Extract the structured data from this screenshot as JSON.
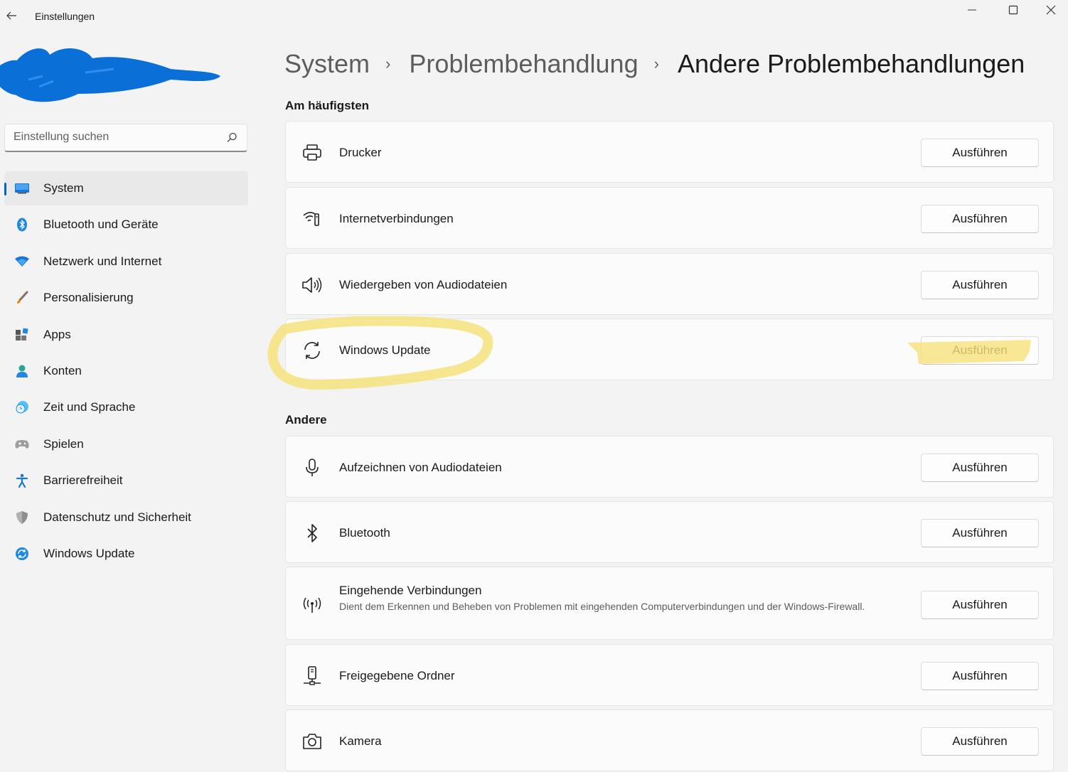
{
  "window": {
    "title": "Einstellungen",
    "controls": [
      "minimize-icon",
      "maximize-icon",
      "close-icon"
    ]
  },
  "search": {
    "placeholder": "Einstellung suchen"
  },
  "sidebar": {
    "items": [
      {
        "label": "System",
        "icon": "system-icon",
        "active": true
      },
      {
        "label": "Bluetooth und Geräte",
        "icon": "bluetooth-icon"
      },
      {
        "label": "Netzwerk und Internet",
        "icon": "wifi-icon"
      },
      {
        "label": "Personalisierung",
        "icon": "brush-icon"
      },
      {
        "label": "Apps",
        "icon": "apps-icon"
      },
      {
        "label": "Konten",
        "icon": "account-icon"
      },
      {
        "label": "Zeit und Sprache",
        "icon": "clock-globe-icon"
      },
      {
        "label": "Spielen",
        "icon": "gamepad-icon"
      },
      {
        "label": "Barrierefreiheit",
        "icon": "accessibility-icon"
      },
      {
        "label": "Datenschutz und Sicherheit",
        "icon": "shield-icon"
      },
      {
        "label": "Windows Update",
        "icon": "windows-update-icon"
      }
    ]
  },
  "header": {
    "breadcrumb": [
      "System",
      "Problembehandlung",
      "Andere Problembehandlungen"
    ],
    "separator": "›"
  },
  "sections": [
    {
      "title": "Am häufigsten",
      "items": [
        {
          "title": "Drucker",
          "icon": "printer-icon",
          "button": "Ausführen"
        },
        {
          "title": "Internetverbindungen",
          "icon": "wifi-signal-icon",
          "button": "Ausführen"
        },
        {
          "title": "Wiedergeben von Audiodateien",
          "icon": "speaker-icon",
          "button": "Ausführen"
        },
        {
          "title": "Windows Update",
          "icon": "refresh-icon",
          "button": "Ausführen"
        }
      ]
    },
    {
      "title": "Andere",
      "items": [
        {
          "title": "Aufzeichnen von Audiodateien",
          "icon": "microphone-icon",
          "button": "Ausführen"
        },
        {
          "title": "Bluetooth",
          "icon": "bluetooth-icon",
          "button": "Ausführen"
        },
        {
          "title": "Eingehende Verbindungen",
          "description": "Dient dem Erkennen und Beheben von Problemen mit eingehenden Computerverbindungen und der Windows-Firewall.",
          "icon": "broadcast-icon",
          "button": "Ausführen"
        },
        {
          "title": "Freigegebene Ordner",
          "icon": "network-share-icon",
          "button": "Ausführen"
        },
        {
          "title": "Kamera",
          "icon": "camera-icon",
          "button": "Ausführen"
        }
      ]
    }
  ],
  "colors": {
    "background": "#f3f3f3",
    "card": "#fbfbfb",
    "accent": "#0067c0",
    "highlight": "#f7e27a",
    "redaction": "#0a6fd6"
  }
}
